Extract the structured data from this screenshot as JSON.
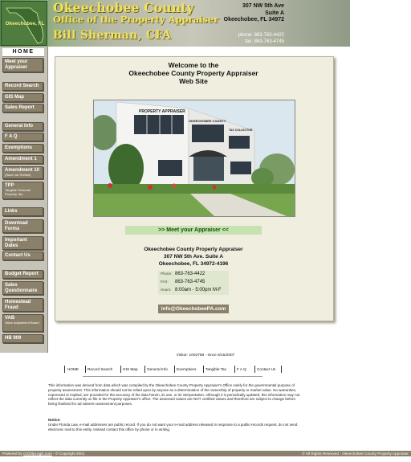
{
  "header": {
    "logo_text": "Okeechobee, FL",
    "title_line1": "Okeechobee County",
    "title_line2": "Office of the Property Appraiser",
    "title_line3": "Bill Sherman, CFA",
    "address": [
      "307 NW 5th Ave",
      "Suite A",
      "Okeechobee, FL 34972"
    ],
    "phone": "phone: 863-763-4422",
    "fax": "fax: 863-763-4745"
  },
  "sidebar": {
    "home": "HOME",
    "items": [
      {
        "label": "Meet your Appraiser",
        "sub": ""
      },
      {
        "label": "Record Search",
        "sub": ""
      },
      {
        "label": "GIS Map",
        "sub": ""
      },
      {
        "label": "Sales Report",
        "sub": ""
      },
      {
        "label": "General Info",
        "sub": ""
      },
      {
        "label": "F A Q",
        "sub": ""
      },
      {
        "label": "Exemptions",
        "sub": ""
      },
      {
        "label": "Amendment 1",
        "sub": ""
      },
      {
        "label": "Amendment 10",
        "sub": "(Save our Homes)"
      },
      {
        "label": "TPP",
        "sub": "Tangible Personal Property Tax"
      },
      {
        "label": "Links",
        "sub": ""
      },
      {
        "label": "Download Forms",
        "sub": ""
      },
      {
        "label": "Important Dates",
        "sub": ""
      },
      {
        "label": "Contact Us",
        "sub": ""
      },
      {
        "label": "Budget Report",
        "sub": ""
      },
      {
        "label": "Sales Questionnaire",
        "sub": ""
      },
      {
        "label": "Homestead Fraud",
        "sub": ""
      },
      {
        "label": "VAB",
        "sub": "Value Adjustment Board"
      },
      {
        "label": "HB 909",
        "sub": ""
      }
    ]
  },
  "main": {
    "welcome_line1": "Welcome to the",
    "welcome_line2": "Okeechobee County Property Appraiser",
    "welcome_line3": "Web Site",
    "building_sign1": "PROPERTY APPRAISER",
    "building_sign2": "OKEECHOBEE COUNTY",
    "building_sign3": "TAX COLLECTOR",
    "meet_link": ">> Meet your Appraiser <<",
    "office_line1": "Okeechobee County Property Appraiser",
    "office_line2": "307 NW 5th Ave. Suite A",
    "office_line3": "Okeechobee, FL 34972-4196",
    "phone_label": "Phone:",
    "phone_value": "863-763-4422",
    "fax_label": "FAX:",
    "fax_value": "863-763-4745",
    "hours_label": "Hours:",
    "hours_value": "8:00am - 5:00pm M-F",
    "email": "info@OkeechobeePA.com"
  },
  "footer": {
    "visitor": "Visitor: 1003788 - since 8/15/2007",
    "nav": [
      "HOME",
      "Record Search",
      "GIS Map",
      "General Info",
      "Exemptions",
      "Tangible Tax",
      "F A Q",
      "Contact Us"
    ],
    "disclaimer": "This information was derived from data which was compiled by the Okeechobee County Property Appraiser's Office solely for the governmental purpose of property assessment. This information should not be relied upon by anyone as a determination of the ownership of property or market value. No warranties, expressed or implied, are provided for the accuracy of the data herein, its use, or its interpretation. Although it is periodically updated, this information may not reflect the data currently on file in the Property Appraiser's office. The assessed values are NOT certified values and therefore are subject to change before being finalized for ad valorem assessment purposes.",
    "notice_heading": "Notice:",
    "notice": "Under Florida Law, e-mail addresses are public record. If you do not want your e-mail address released in response to a public-records request, do not send electronic mail to this entity. Instead contact this office by phone or in writing.",
    "powered_prefix": "Powered by",
    "powered_link": "GrizzlyLogic.com",
    "copyright": "- © Copyright 2001",
    "rights": "© All Rights Reserved - Okeechobee County Property Appraiser"
  }
}
